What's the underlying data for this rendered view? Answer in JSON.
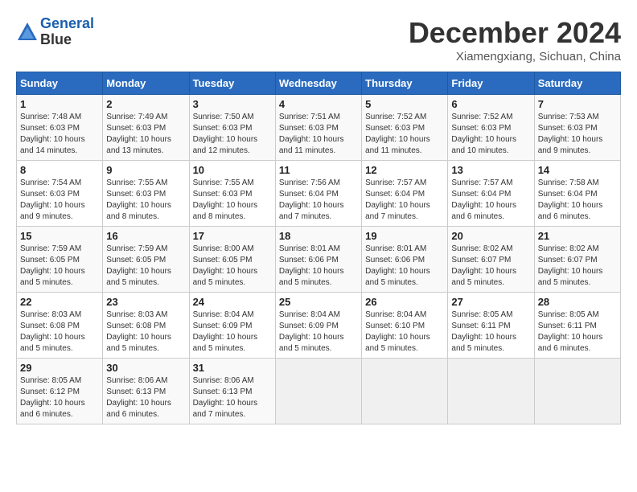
{
  "header": {
    "logo_line1": "General",
    "logo_line2": "Blue",
    "title": "December 2024",
    "location": "Xiamengxiang, Sichuan, China"
  },
  "days_of_week": [
    "Sunday",
    "Monday",
    "Tuesday",
    "Wednesday",
    "Thursday",
    "Friday",
    "Saturday"
  ],
  "weeks": [
    [
      {
        "num": "1",
        "sunrise": "7:48 AM",
        "sunset": "6:03 PM",
        "daylight": "10 hours and 14 minutes."
      },
      {
        "num": "2",
        "sunrise": "7:49 AM",
        "sunset": "6:03 PM",
        "daylight": "10 hours and 13 minutes."
      },
      {
        "num": "3",
        "sunrise": "7:50 AM",
        "sunset": "6:03 PM",
        "daylight": "10 hours and 12 minutes."
      },
      {
        "num": "4",
        "sunrise": "7:51 AM",
        "sunset": "6:03 PM",
        "daylight": "10 hours and 11 minutes."
      },
      {
        "num": "5",
        "sunrise": "7:52 AM",
        "sunset": "6:03 PM",
        "daylight": "10 hours and 11 minutes."
      },
      {
        "num": "6",
        "sunrise": "7:52 AM",
        "sunset": "6:03 PM",
        "daylight": "10 hours and 10 minutes."
      },
      {
        "num": "7",
        "sunrise": "7:53 AM",
        "sunset": "6:03 PM",
        "daylight": "10 hours and 9 minutes."
      }
    ],
    [
      {
        "num": "8",
        "sunrise": "7:54 AM",
        "sunset": "6:03 PM",
        "daylight": "10 hours and 9 minutes."
      },
      {
        "num": "9",
        "sunrise": "7:55 AM",
        "sunset": "6:03 PM",
        "daylight": "10 hours and 8 minutes."
      },
      {
        "num": "10",
        "sunrise": "7:55 AM",
        "sunset": "6:03 PM",
        "daylight": "10 hours and 8 minutes."
      },
      {
        "num": "11",
        "sunrise": "7:56 AM",
        "sunset": "6:04 PM",
        "daylight": "10 hours and 7 minutes."
      },
      {
        "num": "12",
        "sunrise": "7:57 AM",
        "sunset": "6:04 PM",
        "daylight": "10 hours and 7 minutes."
      },
      {
        "num": "13",
        "sunrise": "7:57 AM",
        "sunset": "6:04 PM",
        "daylight": "10 hours and 6 minutes."
      },
      {
        "num": "14",
        "sunrise": "7:58 AM",
        "sunset": "6:04 PM",
        "daylight": "10 hours and 6 minutes."
      }
    ],
    [
      {
        "num": "15",
        "sunrise": "7:59 AM",
        "sunset": "6:05 PM",
        "daylight": "10 hours and 5 minutes."
      },
      {
        "num": "16",
        "sunrise": "7:59 AM",
        "sunset": "6:05 PM",
        "daylight": "10 hours and 5 minutes."
      },
      {
        "num": "17",
        "sunrise": "8:00 AM",
        "sunset": "6:05 PM",
        "daylight": "10 hours and 5 minutes."
      },
      {
        "num": "18",
        "sunrise": "8:01 AM",
        "sunset": "6:06 PM",
        "daylight": "10 hours and 5 minutes."
      },
      {
        "num": "19",
        "sunrise": "8:01 AM",
        "sunset": "6:06 PM",
        "daylight": "10 hours and 5 minutes."
      },
      {
        "num": "20",
        "sunrise": "8:02 AM",
        "sunset": "6:07 PM",
        "daylight": "10 hours and 5 minutes."
      },
      {
        "num": "21",
        "sunrise": "8:02 AM",
        "sunset": "6:07 PM",
        "daylight": "10 hours and 5 minutes."
      }
    ],
    [
      {
        "num": "22",
        "sunrise": "8:03 AM",
        "sunset": "6:08 PM",
        "daylight": "10 hours and 5 minutes."
      },
      {
        "num": "23",
        "sunrise": "8:03 AM",
        "sunset": "6:08 PM",
        "daylight": "10 hours and 5 minutes."
      },
      {
        "num": "24",
        "sunrise": "8:04 AM",
        "sunset": "6:09 PM",
        "daylight": "10 hours and 5 minutes."
      },
      {
        "num": "25",
        "sunrise": "8:04 AM",
        "sunset": "6:09 PM",
        "daylight": "10 hours and 5 minutes."
      },
      {
        "num": "26",
        "sunrise": "8:04 AM",
        "sunset": "6:10 PM",
        "daylight": "10 hours and 5 minutes."
      },
      {
        "num": "27",
        "sunrise": "8:05 AM",
        "sunset": "6:11 PM",
        "daylight": "10 hours and 5 minutes."
      },
      {
        "num": "28",
        "sunrise": "8:05 AM",
        "sunset": "6:11 PM",
        "daylight": "10 hours and 6 minutes."
      }
    ],
    [
      {
        "num": "29",
        "sunrise": "8:05 AM",
        "sunset": "6:12 PM",
        "daylight": "10 hours and 6 minutes."
      },
      {
        "num": "30",
        "sunrise": "8:06 AM",
        "sunset": "6:13 PM",
        "daylight": "10 hours and 6 minutes."
      },
      {
        "num": "31",
        "sunrise": "8:06 AM",
        "sunset": "6:13 PM",
        "daylight": "10 hours and 7 minutes."
      },
      null,
      null,
      null,
      null
    ]
  ]
}
